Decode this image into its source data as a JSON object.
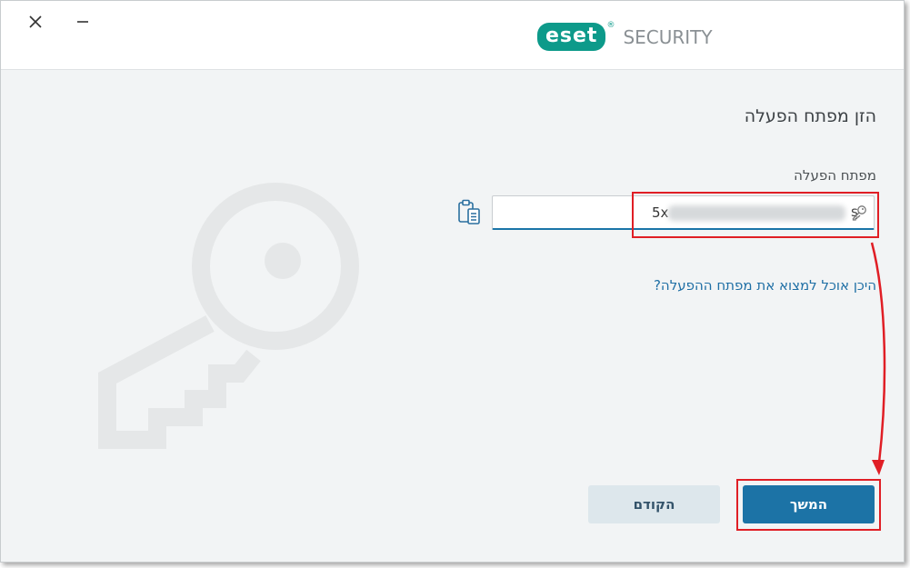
{
  "window": {
    "close_icon": "close-icon",
    "minimize_icon": "minimize-icon"
  },
  "logo": {
    "brand": "eset",
    "registered": "®",
    "product": "SECURITY"
  },
  "main": {
    "heading": "הזן מפתח הפעלה",
    "field_label": "מפתח הפעלה",
    "input_value_start": "5x",
    "input_value_end": "s",
    "paste_icon": "clipboard-icon",
    "key_icon": "key-icon",
    "help_link": "היכן אוכל למצוא את מפתח ההפעלה?"
  },
  "footer": {
    "back_label": "הקודם",
    "continue_label": "המשך"
  },
  "colors": {
    "accent": "#1c73a6",
    "brand": "#0d9a8a",
    "highlight": "#e01e25"
  }
}
